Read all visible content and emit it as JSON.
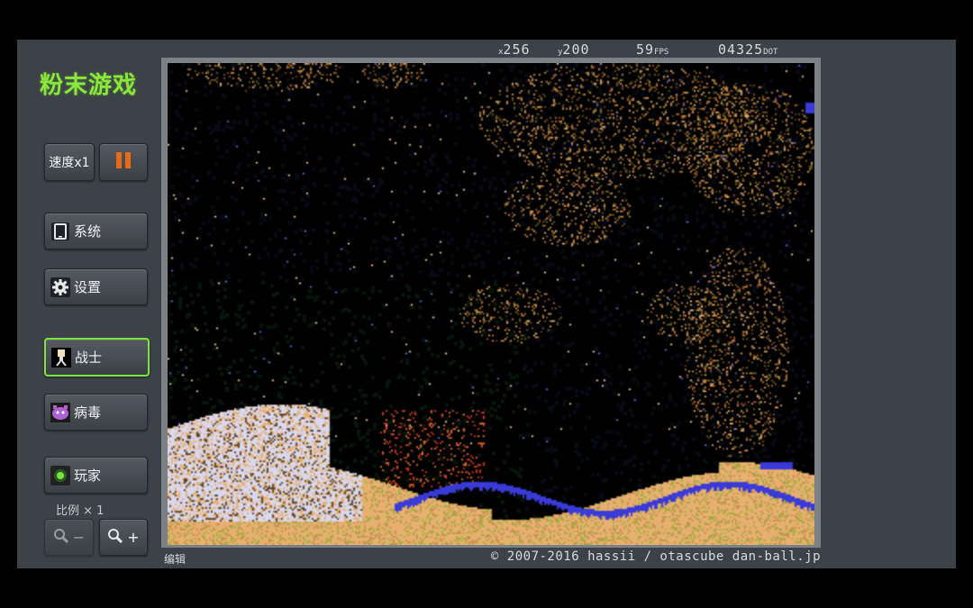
{
  "app": {
    "title": "粉末游戏",
    "speed_label": "速度x1",
    "pause_icon": "pause-icon",
    "menu": {
      "system_label": "系统",
      "settings_label": "设置",
      "fighter_label": "战士",
      "virus_label": "病毒",
      "player_label": "玩家"
    },
    "scale_label": "比例 × 1",
    "zoom_out_label": "−",
    "zoom_in_label": "+",
    "edit_label": "编辑",
    "copyright": "© 2007-2016 hassii / otascube dan-ball.jp"
  },
  "stats": {
    "x": "256",
    "y": "200",
    "fps": "59",
    "fps_unit": "FPS",
    "dots": "04325",
    "dots_unit": "DOT"
  },
  "colors": {
    "accent": "#8ae83a",
    "pause": "#e86a18",
    "panel": "#3c4247",
    "sand": "#e8b070",
    "water": "#3a3ad8",
    "snow": "#d8d8f0",
    "fire": "#e04020"
  }
}
